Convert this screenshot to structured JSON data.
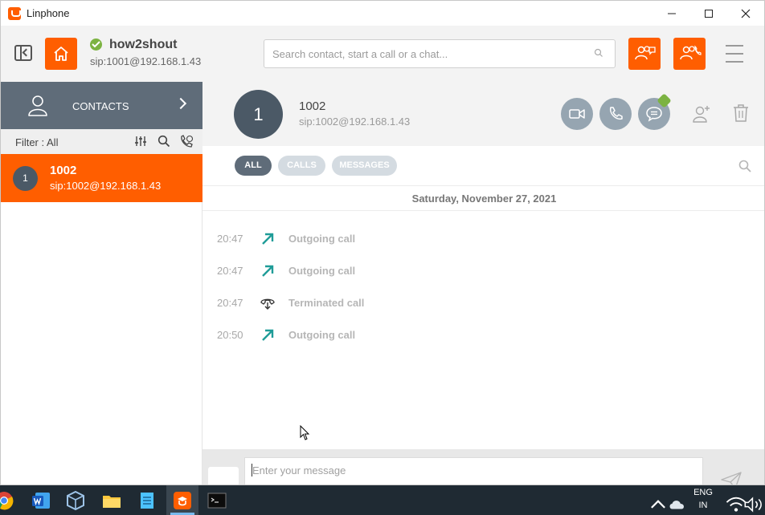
{
  "window": {
    "title": "Linphone",
    "controls": {
      "minimize": "—",
      "maximize": "☐",
      "close": "✕"
    }
  },
  "header": {
    "user_name": "how2shout",
    "user_sip": "sip:1001@192.168.1.43",
    "search_placeholder": "Search contact, start a call or a chat...",
    "icons": [
      "side-panel-icon",
      "home-icon",
      "search-icon",
      "conference-chat-icon",
      "conference-call-icon",
      "hamburger-menu-icon"
    ]
  },
  "sidebar": {
    "nav_label": "CONTACTS",
    "filter_label": "Filter : All",
    "contacts": [
      {
        "avatar": "1",
        "name": "1002",
        "sip": "sip:1002@192.168.1.43"
      }
    ]
  },
  "contact_header": {
    "avatar": "1",
    "name": "1002",
    "sip": "sip:1002@192.168.1.43"
  },
  "tabs": [
    {
      "label": "ALL",
      "active": true
    },
    {
      "label": "CALLS",
      "active": false
    },
    {
      "label": "MESSAGES",
      "active": false
    }
  ],
  "history": {
    "date": "Saturday, November 27, 2021",
    "events": [
      {
        "time": "20:47",
        "type": "outgoing",
        "label": "Outgoing call"
      },
      {
        "time": "20:47",
        "type": "outgoing",
        "label": "Outgoing call"
      },
      {
        "time": "20:47",
        "type": "terminated",
        "label": "Terminated call"
      },
      {
        "time": "20:50",
        "type": "outgoing",
        "label": "Outgoing call"
      }
    ]
  },
  "compose": {
    "placeholder": "Enter your message"
  },
  "taskbar": {
    "language": "ENG",
    "region": "IN"
  },
  "colors": {
    "accent": "#ff5e00",
    "nav": "#5f6c79",
    "status_online": "#7cb342",
    "outgoing_arrow": "#1f9c98"
  }
}
